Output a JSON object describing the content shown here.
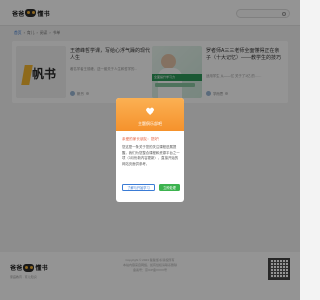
{
  "header": {
    "logo_left": "爸爸",
    "logo_right": "懂书",
    "search_placeholder": ""
  },
  "breadcrumb": {
    "home": "首页",
    "sep": "›",
    "items": [
      "育儿",
      "阅读",
      "书单"
    ]
  },
  "cards": [
    {
      "title": "王德峰哲学课，写给心浮气躁的现代人生",
      "desc": "著名学者王德峰，送一套关于人生和哲学的...",
      "thumb_label": "帆书",
      "meta_author": "帆书",
      "meta_extra": ""
    },
    {
      "title": "罗者师A三三老师全面懂得正在亲子（十大记忆）——教学生的技巧",
      "desc": "适用学生 从——亿 关于了1亿 的……",
      "thumb_banner": "全面提升学习力",
      "meta_author": "学而思",
      "meta_extra": ""
    }
  ],
  "modal": {
    "title": "主题俱乐部吧",
    "greeting": "亲爱的家长朋友：您好！",
    "message": "您这是一条关于您的关注课程进展提醒，我们为您整合课程和资源平台之一项（3月份新内容更新），直接开始的网站页面供参考。",
    "primary_btn": "了解与开始学习",
    "secondary_btn": "立即处理"
  },
  "footer": {
    "logo_left": "爸爸",
    "logo_right": "懂书",
    "subtitle": "家庭教育 · 育儿知识",
    "copyright_line1": "Copyright © 2023 爸爸懂书 版权所有",
    "copyright_line2": "本站内容来自网络，如有侵权请联系删除",
    "copyright_line3": "备案号：京ICP备XXXX号"
  },
  "colors": {
    "accent": "#f5922c",
    "link": "#3a7bd5",
    "ok": "#3cb34f"
  }
}
